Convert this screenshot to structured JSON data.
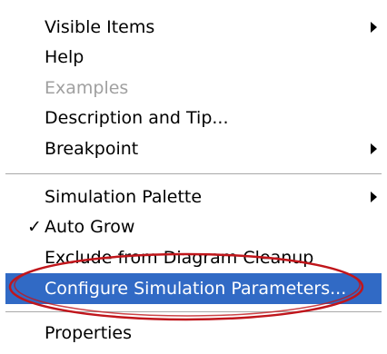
{
  "menu": {
    "items": [
      {
        "label": "Visible Items",
        "submenu": true
      },
      {
        "label": "Help"
      },
      {
        "label": "Examples",
        "disabled": true
      },
      {
        "label": "Description and Tip..."
      },
      {
        "label": "Breakpoint",
        "submenu": true
      },
      {
        "label": "Simulation Palette",
        "submenu": true
      },
      {
        "label": "Auto Grow",
        "checked": true,
        "check_mark": "✓"
      },
      {
        "label": "Exclude from Diagram Cleanup"
      },
      {
        "label": "Configure Simulation Parameters...",
        "highlighted": true
      },
      {
        "label": "Properties"
      }
    ]
  },
  "colors": {
    "highlight": "#316ac5",
    "disabled_text": "#a0a0a0",
    "annotation_ring": "#c0161c"
  }
}
